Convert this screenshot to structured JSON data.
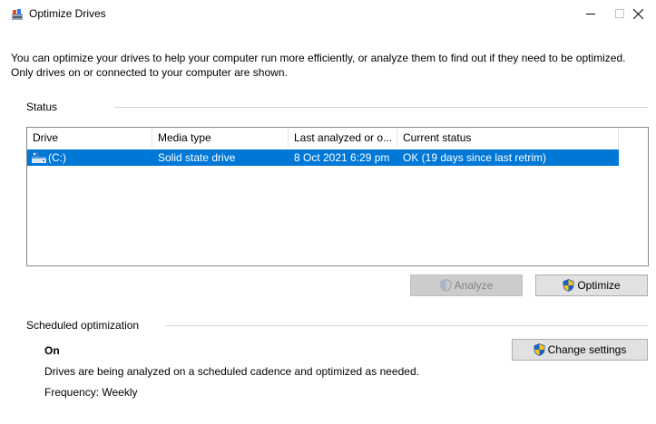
{
  "window": {
    "title": "Optimize Drives",
    "minimize_label": "–",
    "maximize_label": "☐",
    "close_label": "✕"
  },
  "intro_text": "You can optimize your drives to help your computer run more efficiently, or analyze them to find out if they need to be optimized. Only drives on or connected to your computer are shown.",
  "status": {
    "group_label": "Status",
    "columns": [
      "Drive",
      "Media type",
      "Last analyzed or o...",
      "Current status"
    ],
    "rows": [
      {
        "drive": "(C:)",
        "media_type": "Solid state drive",
        "last_analyzed": "8 Oct 2021 6:29 pm",
        "current_status": "OK (19 days since last retrim)",
        "selected": true,
        "icon": "drive-icon"
      }
    ]
  },
  "buttons": {
    "analyze": "Analyze",
    "optimize": "Optimize"
  },
  "scheduled": {
    "group_label": "Scheduled optimization",
    "state": "On",
    "description": "Drives are being analyzed on a scheduled cadence and optimized as needed.",
    "frequency": "Frequency: Weekly",
    "change_settings": "Change settings"
  },
  "colors": {
    "selection": "#0078d7",
    "shield_blue": "#1f5fbf",
    "shield_yellow": "#f5c518"
  }
}
